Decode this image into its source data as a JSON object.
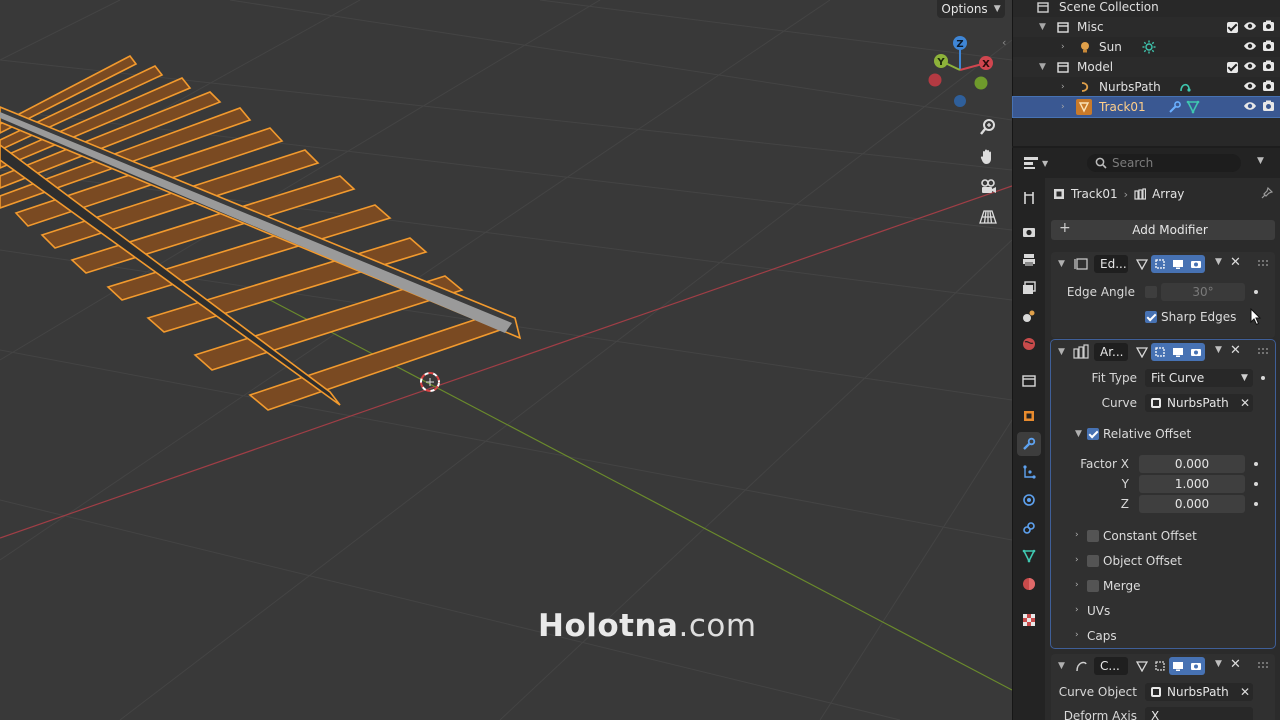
{
  "viewport": {
    "options_label": "Options",
    "watermark_bold": "Holotna",
    "watermark_light": ".com",
    "gizmo_axes": [
      "Z",
      "X",
      "Y"
    ],
    "colors": {
      "x_axis": "#d0464f",
      "y_axis": "#8db23a",
      "z_axis": "#3f86d6",
      "selection_outline": "#f29a2e",
      "background": "#393939"
    }
  },
  "outliner": {
    "rows": [
      {
        "label": "Scene Collection",
        "icon": "scene-collection-icon"
      },
      {
        "label": "Misc",
        "icon": "collection-icon"
      },
      {
        "label": "Sun",
        "icon": "light-icon"
      },
      {
        "label": "Model",
        "icon": "collection-icon"
      },
      {
        "label": "NurbsPath",
        "icon": "curve-icon"
      },
      {
        "label": "Track01",
        "icon": "mesh-icon",
        "selected": true
      }
    ]
  },
  "properties": {
    "search_placeholder": "Search",
    "breadcrumb": {
      "object": "Track01",
      "modifier": "Array"
    },
    "add_modifier_label": "Add Modifier",
    "edge_split": {
      "name": "Ed...",
      "edge_angle_label": "Edge Angle",
      "edge_angle_value": "30°",
      "edge_angle_enabled": false,
      "sharp_edges_label": "Sharp Edges",
      "sharp_edges_checked": true
    },
    "array": {
      "name": "Ar...",
      "fit_type_label": "Fit Type",
      "fit_type_value": "Fit Curve",
      "curve_label": "Curve",
      "curve_value": "NurbsPath",
      "relative_offset_label": "Relative Offset",
      "relative_offset_checked": true,
      "factor_x_label": "Factor X",
      "factor_x": "0.000",
      "y_label": "Y",
      "factor_y": "1.000",
      "z_label": "Z",
      "factor_z": "0.000",
      "constant_offset_label": "Constant Offset",
      "object_offset_label": "Object Offset",
      "merge_label": "Merge",
      "uvs_label": "UVs",
      "caps_label": "Caps"
    },
    "curve_mod": {
      "name": "C...",
      "curve_object_label": "Curve Object",
      "curve_object_value": "NurbsPath",
      "deform_axis_label": "Deform Axis",
      "deform_axis_value": "X"
    }
  }
}
